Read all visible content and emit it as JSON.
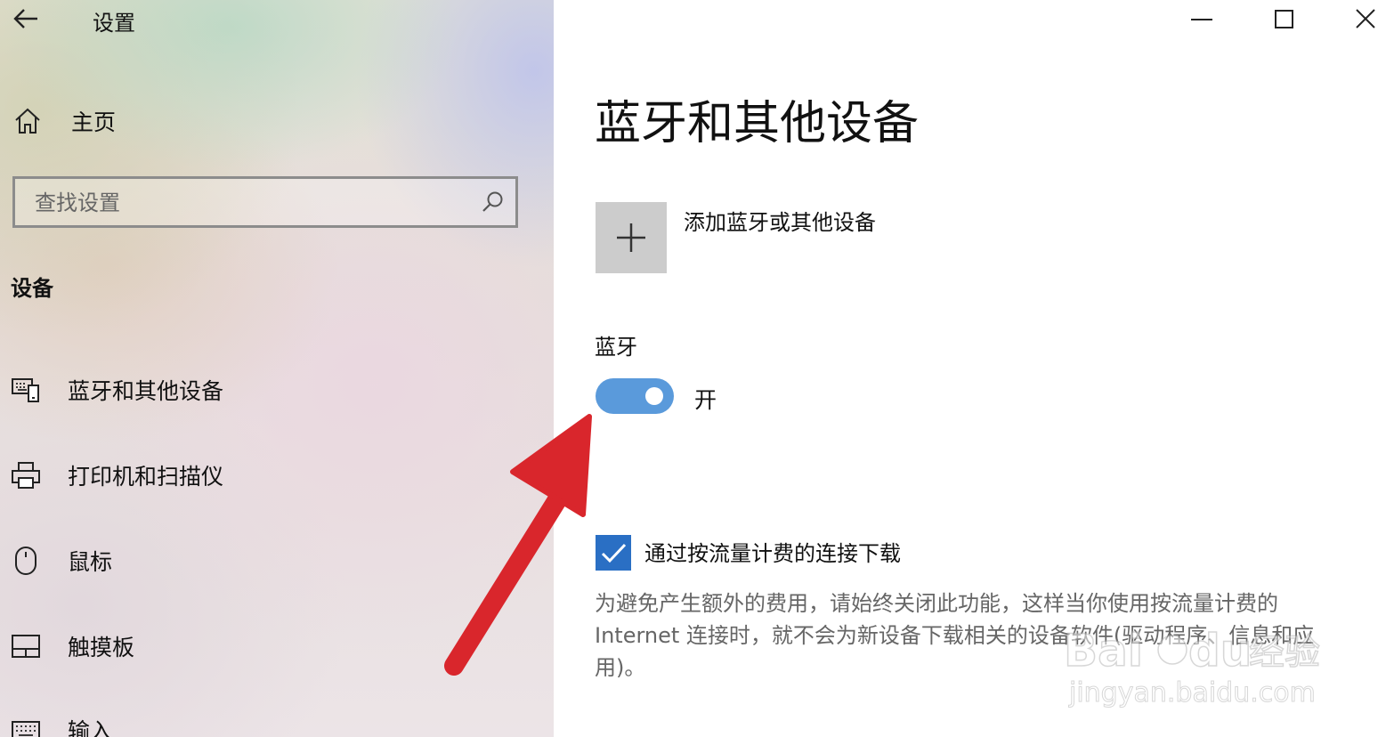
{
  "window": {
    "title": "设置"
  },
  "sidebar": {
    "home_label": "主页",
    "search_placeholder": "查找设置",
    "section_title": "设备",
    "items": [
      {
        "label": "蓝牙和其他设备",
        "icon": "bluetooth-devices-icon"
      },
      {
        "label": "打印机和扫描仪",
        "icon": "printer-icon"
      },
      {
        "label": "鼠标",
        "icon": "mouse-icon"
      },
      {
        "label": "触摸板",
        "icon": "touchpad-icon"
      },
      {
        "label": "输入",
        "icon": "keyboard-icon"
      }
    ]
  },
  "main": {
    "title": "蓝牙和其他设备",
    "add_device_label": "添加蓝牙或其他设备",
    "bluetooth_label": "蓝牙",
    "bluetooth_toggle": {
      "on": true,
      "state_label": "开"
    },
    "metered": {
      "checked": true,
      "label": "通过按流量计费的连接下载",
      "description": "为避免产生额外的费用，请始终关闭此功能，这样当你使用按流量计费的 Internet 连接时，就不会为新设备下载相关的设备软件(驱动程序、信息和应用)。"
    }
  },
  "watermark": {
    "brand": "Baidu",
    "brand_cn": "经验",
    "site": "jingyan.baidu.com"
  },
  "colors": {
    "accent": "#2a6fc4",
    "toggle_on": "#5a9adb",
    "annotation_arrow": "#d9262c"
  }
}
